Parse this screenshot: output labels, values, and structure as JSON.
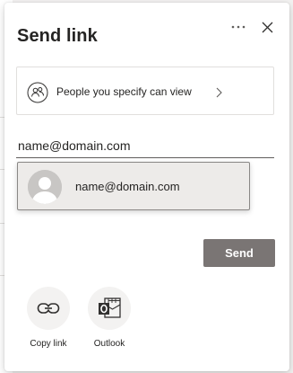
{
  "dialog": {
    "title": "Send link"
  },
  "header": {
    "more_icon": "ellipsis-icon",
    "close_icon": "close-icon"
  },
  "link_settings": {
    "label": "People you specify can view",
    "icon": "people-icon",
    "chevron_icon": "chevron-right-icon"
  },
  "recipient": {
    "value": "name@domain.com"
  },
  "suggestion": {
    "email": "name@domain.com",
    "avatar_icon": "person-avatar-icon"
  },
  "send_label": "Send",
  "share_options": [
    {
      "label": "Copy link",
      "icon": "link-icon"
    },
    {
      "label": "Outlook",
      "icon": "outlook-icon"
    }
  ],
  "colors": {
    "send_button": "#7a7574",
    "suggestion_bg": "#edebe9",
    "option_circle": "#f3f2f1"
  }
}
